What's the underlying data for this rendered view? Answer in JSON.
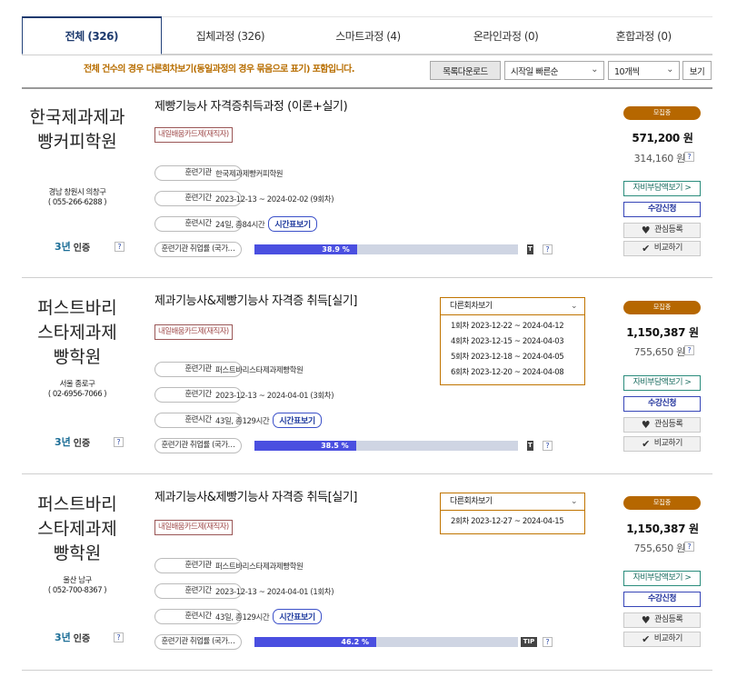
{
  "tabs": [
    {
      "label": "전체 (326)"
    },
    {
      "label": "집체과정 (326)"
    },
    {
      "label": "스마트과정 (4)"
    },
    {
      "label": "온라인과정 (0)"
    },
    {
      "label": "혼합과정 (0)"
    }
  ],
  "notice": "전체 건수의 경우 다른회차보기(동일과정의 경우 묶음으로 표기) 포함입니다.",
  "toolbar": {
    "download": "목록다운로드",
    "sort": "시작일 빠른순",
    "per_page": "10개씩",
    "view": "보기"
  },
  "common": {
    "card_tag": "내일배움카드제(재직자)",
    "lab_org": "훈련기관",
    "lab_period": "훈련기간",
    "lab_time": "훈련시간",
    "lab_emp": "훈련기관 취업률 (국가…",
    "time_btn": "시간표보기",
    "tip": "TIP",
    "q": "?",
    "cert_n": "3년",
    "cert_l": "인증",
    "recruit": "모집중",
    "sb_teal": "자비부담액보기 >",
    "sb_apply": "수강신청",
    "sb_like": "관심등록",
    "sb_cmp": "비교하기",
    "heart_icon": "♥",
    "check_icon": "✔",
    "chevron": "⌄"
  },
  "cards": [
    {
      "inst": [
        "한국제과제과",
        "빵커피학원"
      ],
      "addr1": "경남 창원시 의창구",
      "addr2": "( 055-266-6288 )",
      "title": "제빵기능사 자격증취득과정 (이론+실기)",
      "org": "한국제과제빵커피학원",
      "period": "2023-12-13 ~ 2024-02-02 (9회차)",
      "time": "24일, 총84시간",
      "emp": 38.9,
      "emp_label": "38.9 %",
      "price": "571,200 원",
      "price2": "314,160 원"
    },
    {
      "inst": [
        "퍼스트바리",
        "스타제과제",
        "빵학원"
      ],
      "addr1": "서울 종로구",
      "addr2": "( 02-6956-7066 )",
      "title": "제과기능사&제빵기능사 자격증 취득[실기]",
      "org": "퍼스트바리스타제과제빵학원",
      "period": "2023-12-13 ~ 2024-04-01 (3회차)",
      "time": "43일, 총129시간",
      "emp": 38.5,
      "emp_label": "38.5 %",
      "price": "1,150,387 원",
      "price2": "755,650 원",
      "dd": "다른회차보기",
      "dd_items": [
        "1회차 2023-12-22 ~ 2024-04-12",
        "4회차 2023-12-15 ~ 2024-04-03",
        "5회차 2023-12-18 ~ 2024-04-05",
        "6회차 2023-12-20 ~ 2024-04-08"
      ]
    },
    {
      "inst": [
        "퍼스트바리",
        "스타제과제",
        "빵학원"
      ],
      "addr1": "울산 남구",
      "addr2": "( 052-700-8367 )",
      "title": "제과기능사&제빵기능사 자격증 취득[실기]",
      "org": "퍼스트바리스타제과제빵학원",
      "period": "2023-12-13 ~ 2024-04-01 (1회차)",
      "time": "43일, 총129시간",
      "emp": 46.2,
      "emp_label": "46.2 %",
      "price": "1,150,387 원",
      "price2": "755,650 원",
      "dd": "다른회차보기",
      "dd_items": [
        "2회차 2023-12-27 ~ 2024-04-15"
      ]
    }
  ]
}
